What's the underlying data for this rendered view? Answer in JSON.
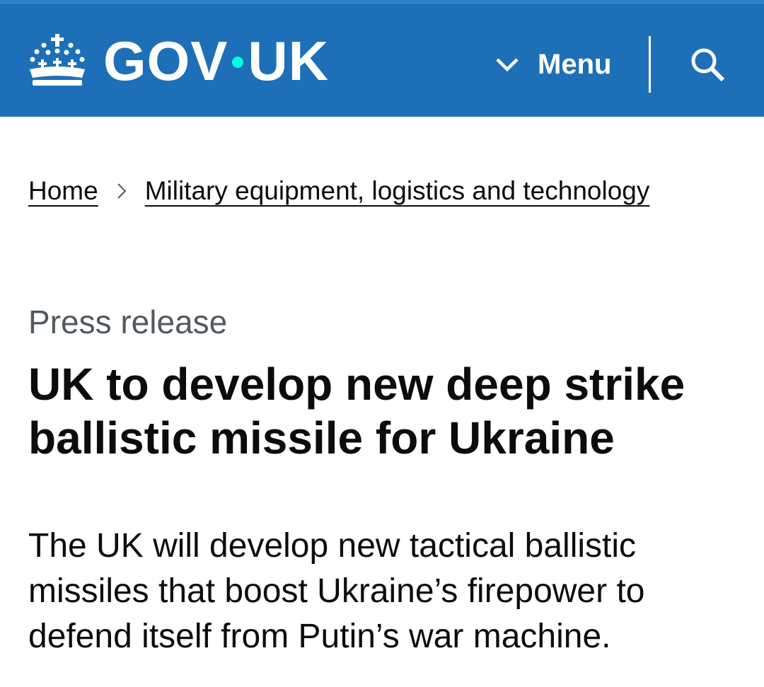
{
  "header": {
    "logo_text_left": "GOV",
    "logo_text_right": "UK",
    "menu_label": "Menu",
    "menu_icon": "chevron-down-icon",
    "search_icon": "search-icon",
    "logo_icon": "crown-icon",
    "background_color": "#1d70b8",
    "dot_color": "#00ffe0"
  },
  "breadcrumb": {
    "items": [
      {
        "label": "Home"
      },
      {
        "label": "Military equipment, logistics and technology"
      }
    ]
  },
  "main": {
    "caption": "Press release",
    "title": "UK to develop new deep strike ballistic missile for Ukraine",
    "lead": "The UK will develop new tactical ballistic missiles that boost Ukraine’s firepower to defend itself from Putin’s war machine."
  }
}
